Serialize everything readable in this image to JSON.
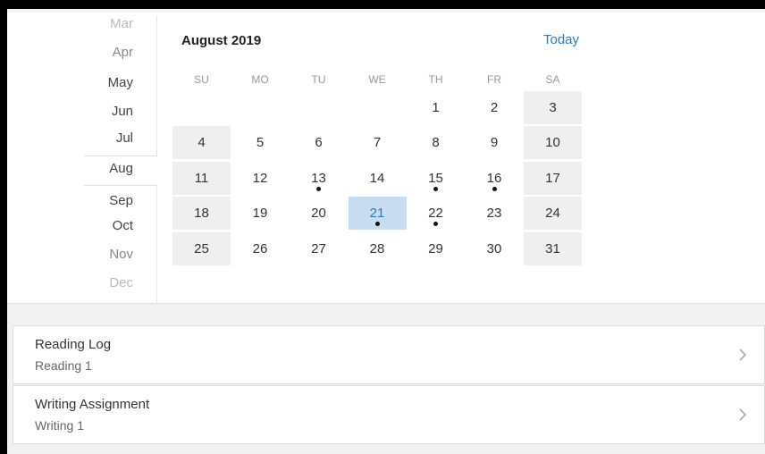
{
  "calendar": {
    "title": "August 2019",
    "today_label": "Today",
    "months": [
      "Mar",
      "Apr",
      "May",
      "Jun",
      "Jul",
      "Aug",
      "Sep",
      "Oct",
      "Nov",
      "Dec"
    ],
    "selected_month": "Aug",
    "weekdays": [
      "SU",
      "MO",
      "TU",
      "WE",
      "TH",
      "FR",
      "SA"
    ],
    "weeks": [
      [
        "",
        "",
        "",
        "",
        "1",
        "2",
        "3"
      ],
      [
        "4",
        "5",
        "6",
        "7",
        "8",
        "9",
        "10"
      ],
      [
        "11",
        "12",
        "13",
        "14",
        "15",
        "16",
        "17"
      ],
      [
        "18",
        "19",
        "20",
        "21",
        "22",
        "23",
        "24"
      ],
      [
        "25",
        "26",
        "27",
        "28",
        "29",
        "30",
        "31"
      ]
    ],
    "selected_day": "21",
    "days_with_events": [
      "13",
      "15",
      "16",
      "21",
      "22"
    ],
    "colors": {
      "accent": "#2b7bbf",
      "selected_bg": "#c9ddf0",
      "weekend_bg": "#efefef"
    }
  },
  "assignments": [
    {
      "title": "Reading Log",
      "subtitle": "Reading 1"
    },
    {
      "title": "Writing Assignment",
      "subtitle": "Writing 1"
    }
  ]
}
